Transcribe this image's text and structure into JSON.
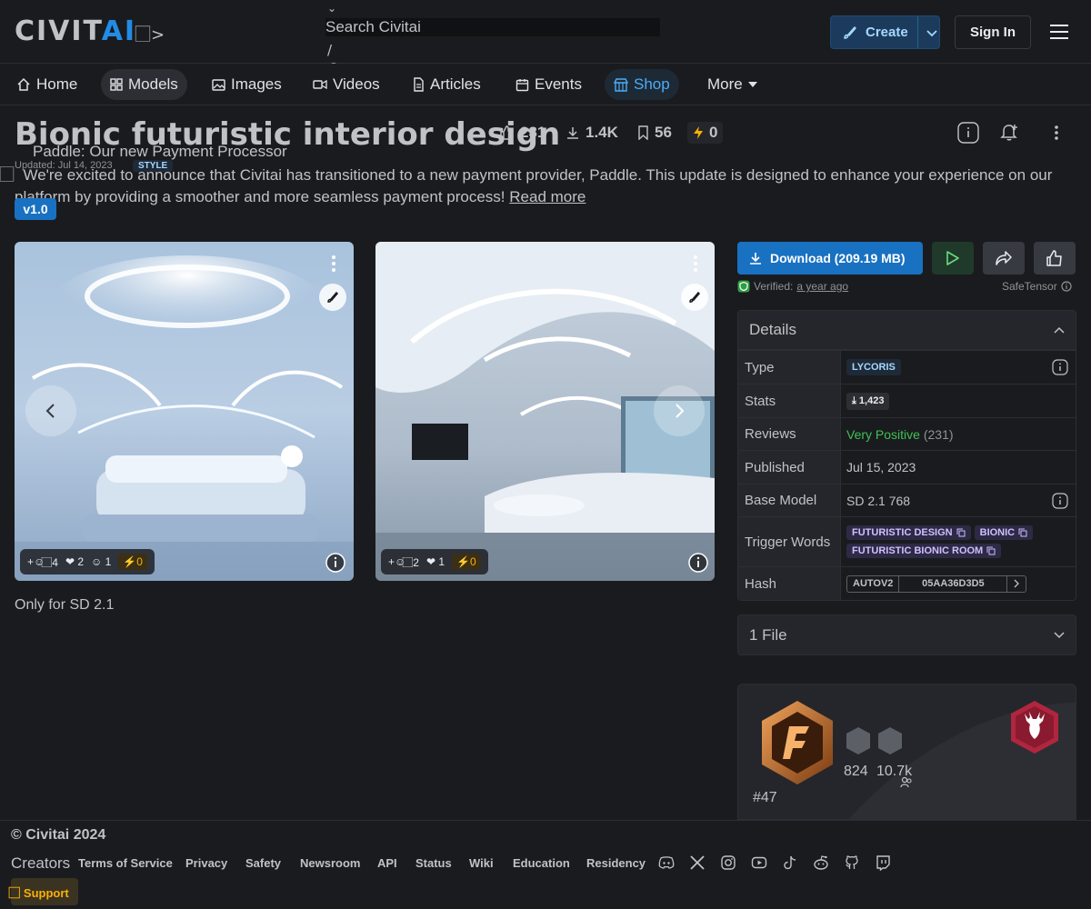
{
  "header": {
    "logo_civit": "CIVIT",
    "logo_ai": "AI",
    "logo_chevron": "⃞>",
    "search_placeholder": "Search Civitai",
    "search_chevron": "⌄",
    "search_shortcut": "/",
    "create_label": "Create",
    "signin_label": "Sign In"
  },
  "nav": {
    "items": [
      {
        "label": "Home",
        "icon": "home-icon"
      },
      {
        "label": "Models",
        "icon": "grid-icon"
      },
      {
        "label": "Images",
        "icon": "photo-icon"
      },
      {
        "label": "Videos",
        "icon": "video-icon"
      },
      {
        "label": "Articles",
        "icon": "article-icon"
      },
      {
        "label": "Events",
        "icon": "calendar-icon"
      },
      {
        "label": "Shop",
        "icon": "shop-icon"
      },
      {
        "label": "More",
        "icon": "caret-down-icon"
      }
    ]
  },
  "model": {
    "title": "Bionic futuristic interior design",
    "likes": "231",
    "downloads": "1.4K",
    "bookmarks": "56",
    "buzz": "0",
    "updated": "Updated: Jul 14, 2023",
    "style_badge": "STYLE",
    "version": "v1.0"
  },
  "announcement": {
    "title": "Paddle: Our new Payment Processor",
    "icon_glyph": "⃞",
    "body": "We're excited to announce that Civitai has transitioned to a new payment provider, Paddle. This update is designed to enhance your experience on our platform by providing a smoother and more seamless payment process!",
    "read_more": "Read more"
  },
  "gallery": [
    {
      "emoji_add": "+☺",
      "comments": "4",
      "hearts": "2",
      "laughs": "1",
      "buzz": "0",
      "comment_glyph": "⃞"
    },
    {
      "emoji_add": "+☺",
      "comments": "2",
      "hearts": "1",
      "buzz": "0",
      "comment_glyph": "⃞"
    }
  ],
  "caption": "Only for SD 2.1",
  "download": {
    "label": "Download (209.19 MB)",
    "verified_prefix": "Verified:",
    "verified_when": "a year ago",
    "format": "SafeTensor"
  },
  "details": {
    "header": "Details",
    "rows": {
      "type_k": "Type",
      "type_v": "LYCORIS",
      "stats_k": "Stats",
      "stats_v": "1,423",
      "reviews_k": "Reviews",
      "reviews_v": "Very Positive",
      "reviews_count": "(231)",
      "published_k": "Published",
      "published_v": "Jul 15, 2023",
      "base_k": "Base Model",
      "base_v": "SD 2.1 768",
      "trigger_k": "Trigger Words",
      "trigger_words": [
        "FUTURISTIC DESIGN",
        "BIONIC",
        "FUTURISTIC BIONIC ROOM"
      ],
      "hash_k": "Hash",
      "hash_type": "AUTOV2",
      "hash_v": "05AA36D3D5"
    }
  },
  "files": {
    "label": "1 File"
  },
  "creator": {
    "count_a": "824",
    "count_b": "10.7k",
    "rank": "#47"
  },
  "footer": {
    "copyright": "© Civitai 2024",
    "creators": "Creators",
    "links": [
      "Terms of Service",
      "Privacy",
      "Safety",
      "Newsroom",
      "API",
      "Status",
      "Wiki",
      "Education",
      "Residency"
    ],
    "support": "⃞ Support"
  },
  "colors": {
    "accent": "#228be6",
    "positive": "#40c057",
    "buzz": "#fab005"
  }
}
